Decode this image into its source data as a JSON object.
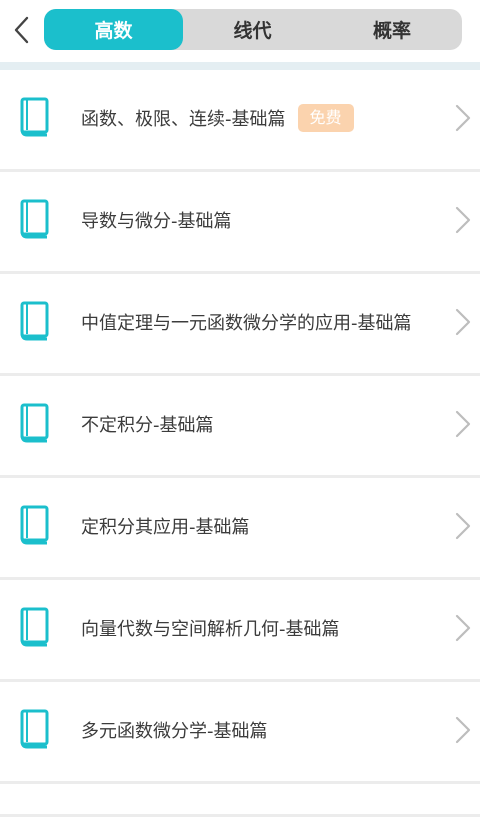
{
  "header": {
    "tabs": [
      {
        "label": "高数",
        "active": true
      },
      {
        "label": "线代",
        "active": false
      },
      {
        "label": "概率",
        "active": false
      }
    ]
  },
  "list": {
    "items": [
      {
        "title": "函数、极限、连续-基础篇",
        "badge": "免费"
      },
      {
        "title": "导数与微分-基础篇"
      },
      {
        "title": "中值定理与一元函数微分学的应用-基础篇"
      },
      {
        "title": "不定积分-基础篇"
      },
      {
        "title": "定积分其应用-基础篇"
      },
      {
        "title": "向量代数与空间解析几何-基础篇"
      },
      {
        "title": "多元函数微分学-基础篇"
      }
    ]
  },
  "colors": {
    "accent": "#1bbfcc",
    "badge_bg": "#fbd3ae",
    "tab_bg": "#d9d9d9"
  },
  "icons": {
    "back": "chevron-left-icon",
    "item": "book-icon",
    "item_arrow": "chevron-right-icon"
  }
}
